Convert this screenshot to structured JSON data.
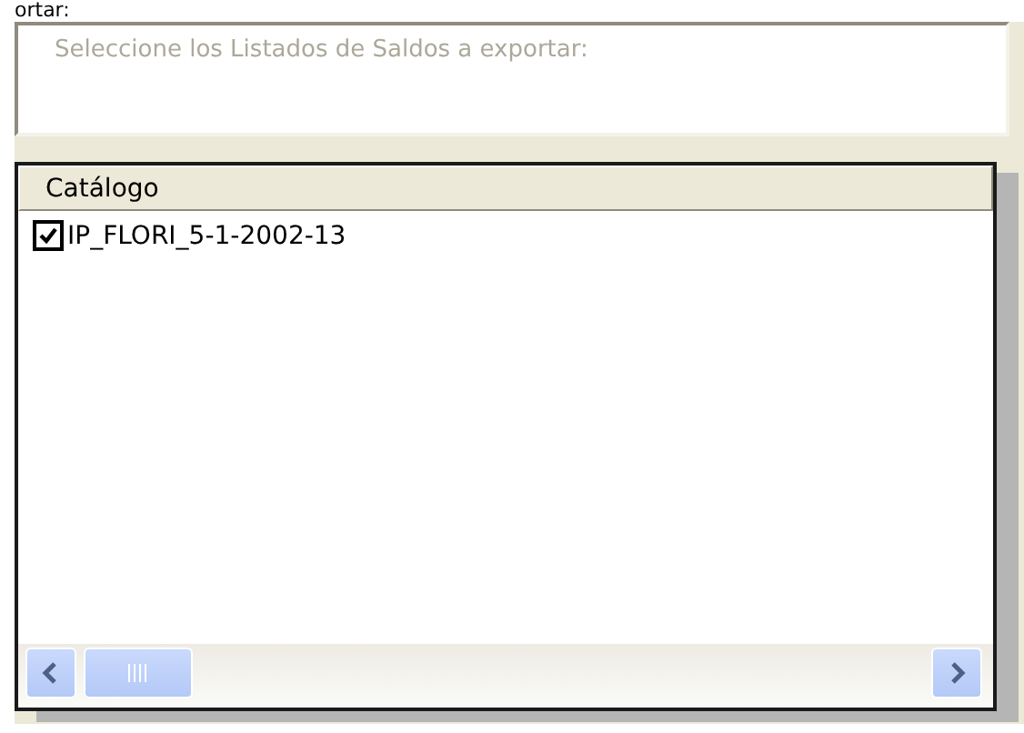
{
  "heading": "ortar:",
  "description": {
    "placeholder": "Seleccione los Listados de Saldos a exportar:"
  },
  "list": {
    "columns": [
      "Catálogo"
    ],
    "rows": [
      {
        "label": "IP_FLORI_5-1-2002-13",
        "checked": true
      }
    ]
  }
}
